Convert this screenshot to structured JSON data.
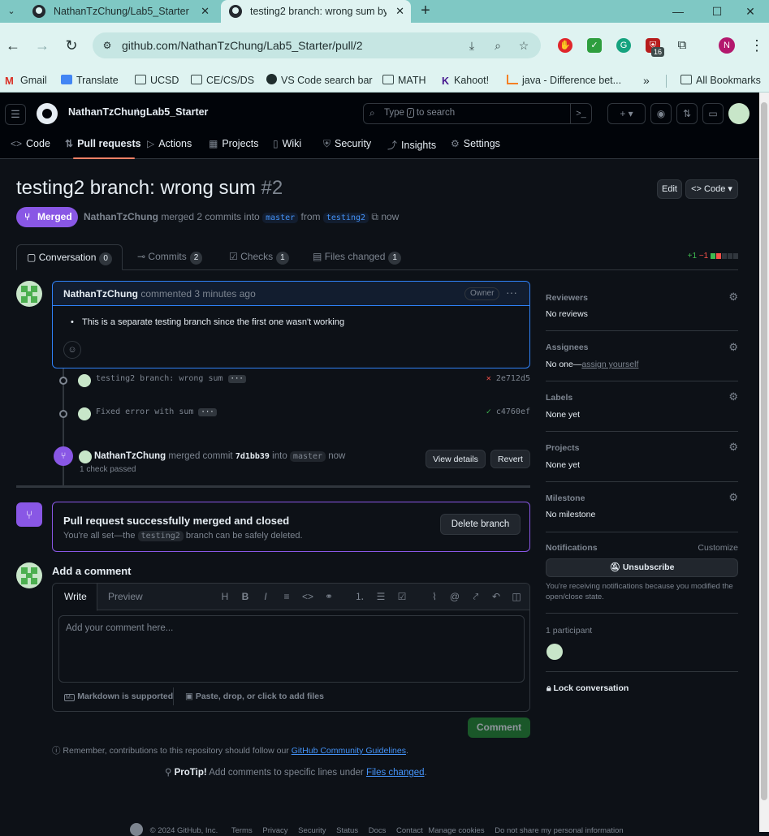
{
  "browser": {
    "tab_dropdown_icon": "chevron-down-icon",
    "tabs": [
      {
        "title": "NathanTzChung/Lab5_Starter",
        "active": false
      },
      {
        "title": "testing2 branch: wrong sum by",
        "active": true
      }
    ],
    "url": "github.com/NathanTzChung/Lab5_Starter/pull/2",
    "extension_badge": "16",
    "profile_initial": "N",
    "bookmarks": [
      "Gmail",
      "Translate",
      "UCSD",
      "CE/CS/DS",
      "VS Code search bar",
      "MATH",
      "Kahoot!",
      "java - Difference bet...",
      "All Bookmarks"
    ],
    "bookmarks_overflow": "»"
  },
  "header": {
    "owner": "NathanTzChung",
    "separator": "/",
    "repo": "Lab5_Starter",
    "search_placeholder_pre": "Type",
    "search_key": "/",
    "search_placeholder_post": "to search",
    "nav": [
      "Code",
      "Pull requests",
      "Actions",
      "Projects",
      "Wiki",
      "Security",
      "Insights",
      "Settings"
    ]
  },
  "pr": {
    "title": "testing2 branch: wrong sum",
    "number": "#2",
    "edit_label": "Edit",
    "code_label": "Code",
    "state": "Merged",
    "author": "NathanTzChung",
    "meta_merged": "merged 2 commits into",
    "base_branch": "master",
    "meta_from": "from",
    "head_branch": "testing2",
    "meta_time": "now",
    "tabs": [
      {
        "label": "Conversation",
        "count": "0"
      },
      {
        "label": "Commits",
        "count": "2"
      },
      {
        "label": "Checks",
        "count": "1"
      },
      {
        "label": "Files changed",
        "count": "1"
      }
    ],
    "additions": "+1",
    "deletions": "−1"
  },
  "comment": {
    "author": "NathanTzChung",
    "action": "commented 3 minutes ago",
    "role": "Owner",
    "body": "This is a separate testing branch since the first one wasn't working"
  },
  "commits": [
    {
      "message": "testing2 branch: wrong sum",
      "status": "fail",
      "status_icon": "✕",
      "sha": "2e712d5"
    },
    {
      "message": "Fixed error with sum",
      "status": "ok",
      "status_icon": "✓",
      "sha": "c4760ef"
    }
  ],
  "merge_event": {
    "author": "NathanTzChung",
    "action": "merged commit",
    "commit": "7d1bb39",
    "into": "into",
    "branch": "master",
    "time": "now",
    "checks": "1 check passed",
    "view_details": "View details",
    "revert": "Revert"
  },
  "merged_box": {
    "title": "Pull request successfully merged and closed",
    "subtitle_pre": "You're all set—the",
    "branch": "testing2",
    "subtitle_post": "branch can be safely deleted.",
    "delete_label": "Delete branch"
  },
  "editor": {
    "heading": "Add a comment",
    "write_tab": "Write",
    "preview_tab": "Preview",
    "placeholder": "Add your comment here...",
    "markdown_note": "Markdown is supported",
    "attach_note": "Paste, drop, or click to add files",
    "submit_label": "Comment"
  },
  "notes": {
    "guidelines_pre": "Remember, contributions to this repository should follow our",
    "guidelines_link": "GitHub Community Guidelines",
    "guidelines_post": ".",
    "protip_label": "ProTip!",
    "protip_text": "Add comments to specific lines under",
    "protip_link": "Files changed",
    "protip_post": "."
  },
  "sidebar": {
    "reviewers": {
      "label": "Reviewers",
      "value": "No reviews"
    },
    "assignees": {
      "label": "Assignees",
      "value": "No one—",
      "link": "assign yourself"
    },
    "labels": {
      "label": "Labels",
      "value": "None yet"
    },
    "projects": {
      "label": "Projects",
      "value": "None yet"
    },
    "milestone": {
      "label": "Milestone",
      "value": "No milestone"
    },
    "notifications": {
      "label": "Notifications",
      "customize": "Customize",
      "button": "Unsubscribe",
      "reason": "You're receiving notifications because you modified the open/close state."
    },
    "participants": "1 participant",
    "lock": "Lock conversation"
  },
  "footer": {
    "copyright": "© 2024 GitHub, Inc.",
    "links": [
      "Terms",
      "Privacy",
      "Security",
      "Status",
      "Docs",
      "Contact",
      "Manage cookies",
      "Do not share my personal information"
    ]
  },
  "colors": {
    "merged": "#8957e5",
    "link": "#4493f8",
    "success": "#3fb950",
    "danger": "#f85149",
    "bg": "#0d1117"
  }
}
